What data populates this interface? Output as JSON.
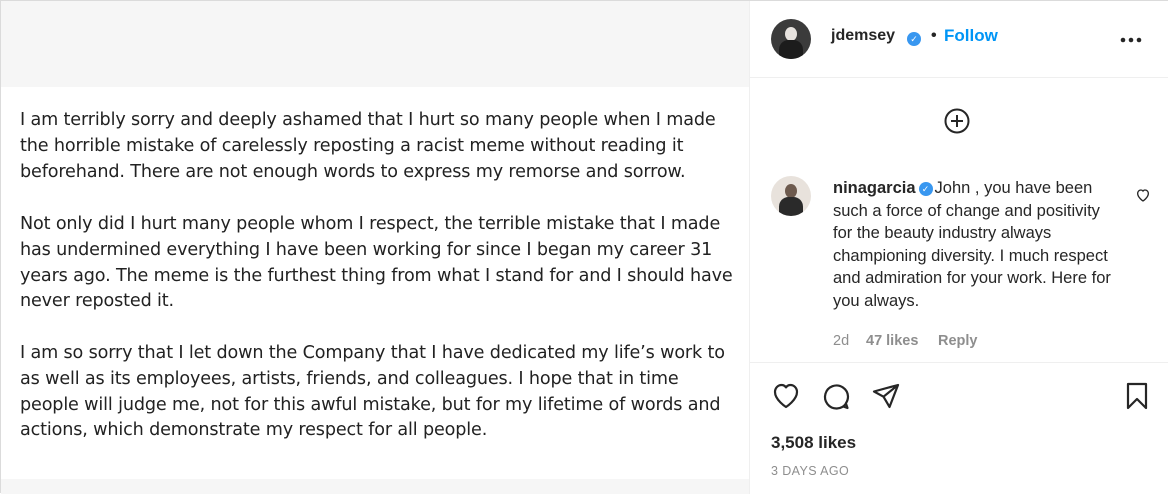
{
  "post_image": {
    "paragraphs": [
      "I am terribly sorry and deeply ashamed that I hurt so many people when I made the horrible mistake of carelessly reposting a racist meme without reading it beforehand. There are not enough words to express my remorse and sorrow.",
      "Not only did I hurt many people whom I respect, the terrible mistake that I made has undermined everything I have been working for since I began my career 31 years ago.  The meme is the furthest thing from what I stand for and I should have never reposted it.",
      "I am so sorry that I let down the Company that I have dedicated my life’s work to as well as its employees, artists, friends, and colleagues.  I hope that in time people will judge me, not for this awful mistake, but for my lifetime of words and actions, which demonstrate my respect for all people."
    ]
  },
  "header": {
    "username": "jdemsey",
    "separator": "•",
    "follow_label": "Follow",
    "more_label": "•••"
  },
  "comment": {
    "username": "ninagarcia",
    "text": "John , you have been such a force of change and positivity for the beauty industry always championing diversity. I much respect and admiration for your work. Here for you always.",
    "time": "2d",
    "likes": "47 likes",
    "reply_label": "Reply"
  },
  "footer": {
    "likes": "3,508 likes",
    "date": "3 DAYS AGO"
  },
  "colors": {
    "accent": "#0095f6",
    "verified": "#3897f0",
    "muted": "#8e8e8e",
    "text": "#262626"
  },
  "icons": {
    "add": "add-circle-icon",
    "like": "heart-icon",
    "comment": "comment-bubble-icon",
    "share": "paper-plane-icon",
    "save": "bookmark-icon",
    "comment_like": "small-heart-icon",
    "verified": "verified-badge-icon"
  }
}
